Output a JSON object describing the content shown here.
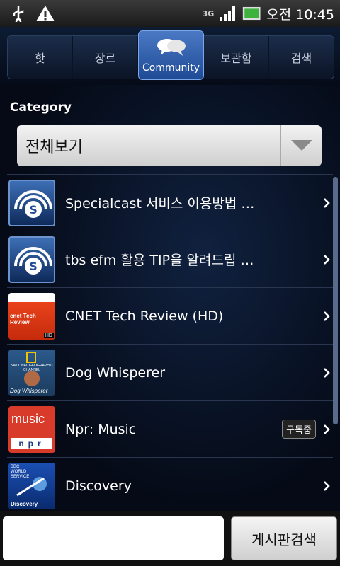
{
  "status_bar": {
    "network": "3G",
    "time": "오전 10:45",
    "icons": [
      "usb-icon",
      "warning-icon",
      "signal-icon",
      "battery-icon"
    ]
  },
  "tabs": [
    {
      "label": "핫",
      "active": false
    },
    {
      "label": "장르",
      "active": false
    },
    {
      "label": "Community",
      "active": true
    },
    {
      "label": "보관함",
      "active": false
    },
    {
      "label": "검색",
      "active": false
    }
  ],
  "category": {
    "label": "Category",
    "selected": "전체보기"
  },
  "items": [
    {
      "title": "Specialcast 서비스 이용방법 …",
      "thumb": "specialcast-logo",
      "badge": ""
    },
    {
      "title": "tbs efm 활용 TIP을 알려드립 …",
      "thumb": "specialcast-logo",
      "badge": ""
    },
    {
      "title": "CNET Tech Review (HD)",
      "thumb": "cnet-tech-review",
      "badge": "",
      "thumb_text": "cnet Tech Review",
      "thumb_tag": "HD"
    },
    {
      "title": "Dog Whisperer",
      "thumb": "dog-whisperer",
      "badge": "",
      "thumb_text": "NATIONAL GEOGRAPHIC CHANNEL",
      "thumb_tag": "Dog Whisperer"
    },
    {
      "title": "Npr: Music",
      "thumb": "npr-music",
      "badge": "구독중",
      "thumb_text": "music",
      "thumb_tag": "npr"
    },
    {
      "title": "Discovery",
      "thumb": "bbc-discovery",
      "badge": "",
      "thumb_text": "BBC WORLD SERVICE",
      "thumb_tag": "Discovery"
    }
  ],
  "bottom": {
    "search_placeholder": "",
    "search_button": "게시판검색"
  },
  "colors": {
    "accent": "#2e5fb0",
    "background": "#050a16"
  }
}
